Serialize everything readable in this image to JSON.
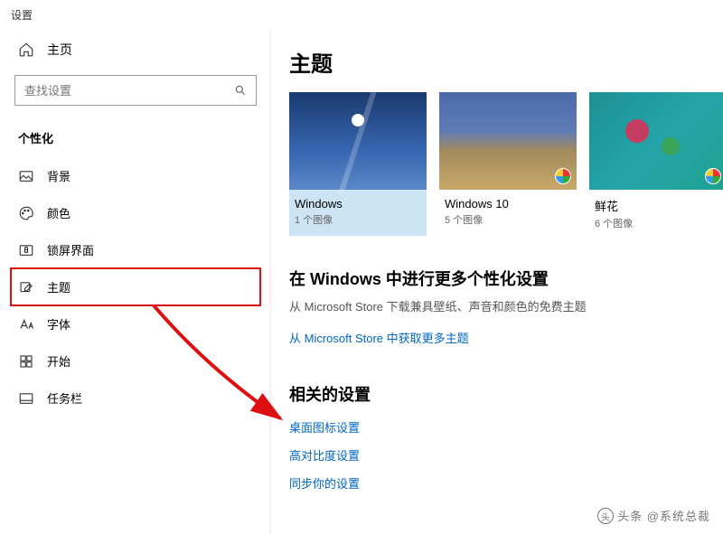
{
  "window": {
    "title": "设置"
  },
  "sidebar": {
    "home": "主页",
    "search_placeholder": "查找设置",
    "section": "个性化",
    "items": [
      {
        "label": "背景"
      },
      {
        "label": "颜色"
      },
      {
        "label": "锁屏界面"
      },
      {
        "label": "主题"
      },
      {
        "label": "字体"
      },
      {
        "label": "开始"
      },
      {
        "label": "任务栏"
      }
    ]
  },
  "content": {
    "title": "主题",
    "themes": [
      {
        "name": "Windows",
        "meta": "1 个图像"
      },
      {
        "name": "Windows 10",
        "meta": "5 个图像"
      },
      {
        "name": "鲜花",
        "meta": "6 个图像"
      }
    ],
    "more": {
      "heading": "在 Windows 中进行更多个性化设置",
      "sub": "从 Microsoft Store 下载兼具壁纸、声音和颜色的免费主题",
      "link": "从 Microsoft Store 中获取更多主题"
    },
    "related": {
      "heading": "相关的设置",
      "links": [
        "桌面图标设置",
        "高对比度设置",
        "同步你的设置"
      ]
    }
  },
  "watermark": "头条 @系统总裁"
}
